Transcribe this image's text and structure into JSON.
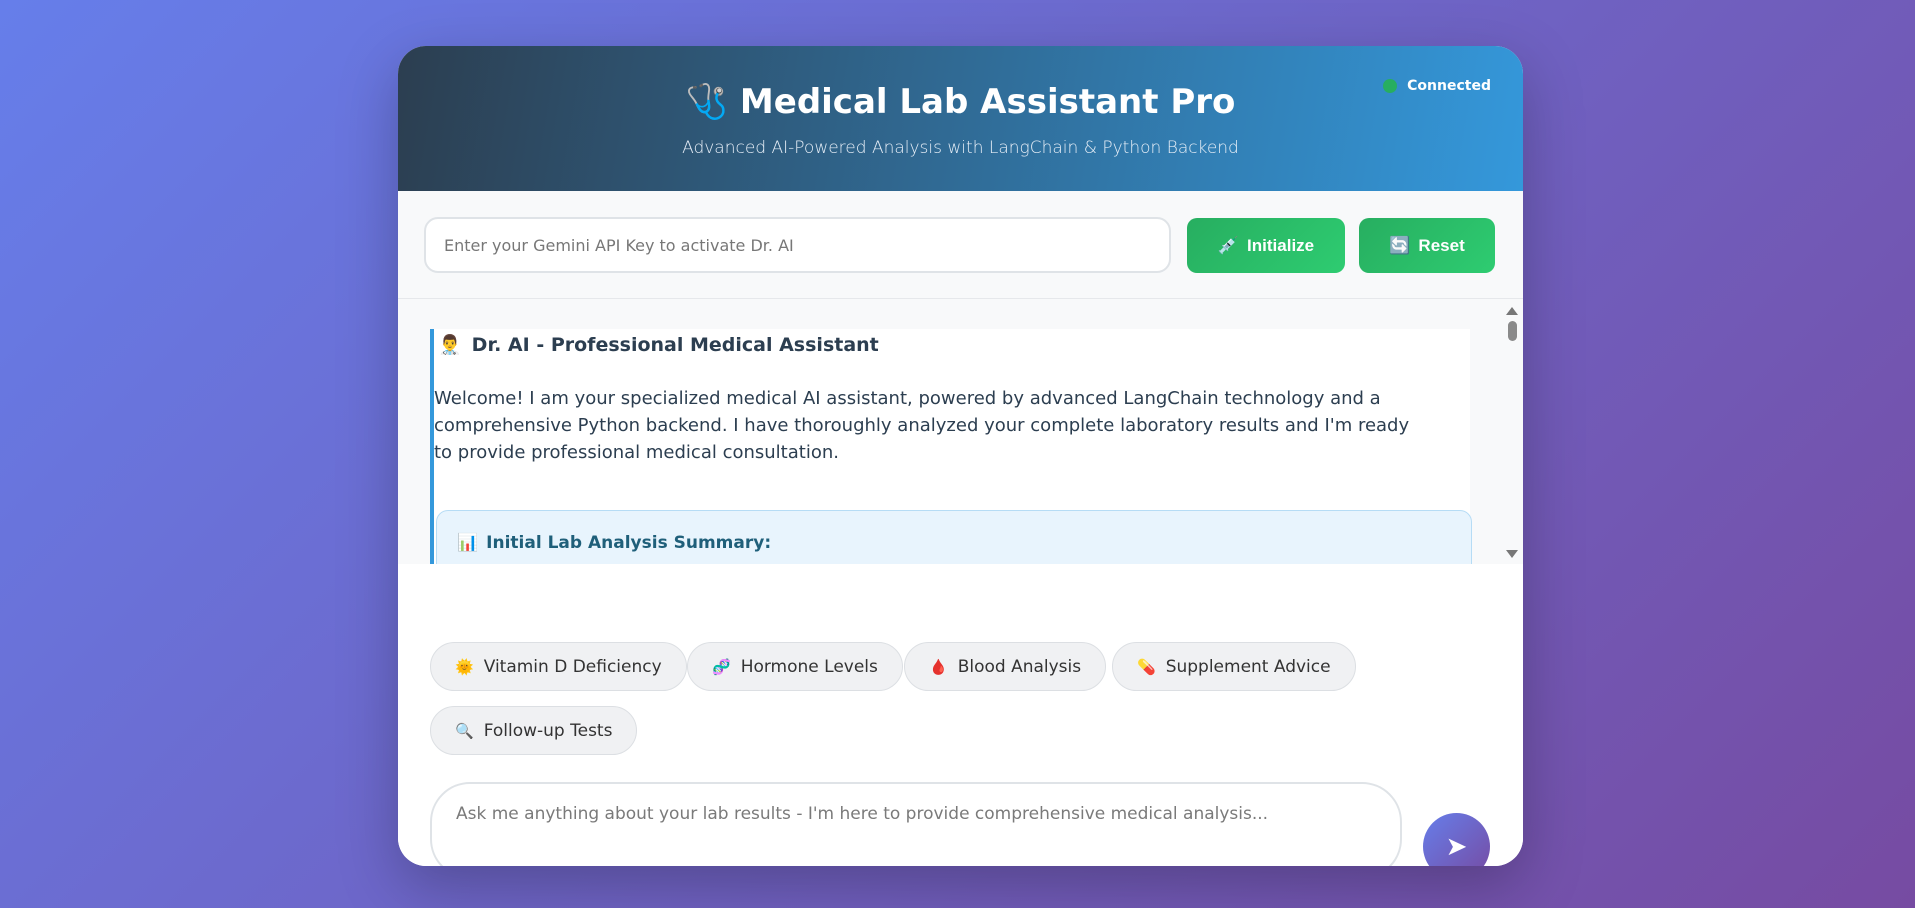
{
  "header": {
    "title": "Medical Lab Assistant Pro",
    "title_icon": "🩺",
    "subtitle": "Advanced AI-Powered Analysis with LangChain & Python Backend",
    "status_text": "Connected",
    "status_color": "#27ae60"
  },
  "api": {
    "placeholder": "Enter your Gemini API Key to activate Dr. AI",
    "value": "",
    "initialize_icon": "💉",
    "initialize_label": "Initialize",
    "reset_icon": "🔄",
    "reset_label": "Reset"
  },
  "chat": {
    "message": {
      "avatar_icon": "👨‍⚕️",
      "title": "Dr. AI - Professional Medical Assistant",
      "body": "Welcome! I am your specialized medical AI assistant, powered by advanced LangChain technology and a comprehensive Python backend. I have thoroughly analyzed your complete laboratory results and I'm ready to provide professional medical consultation.",
      "summary_icon": "📊",
      "summary_title": "Initial Lab Analysis Summary:"
    }
  },
  "quick_actions": [
    {
      "icon": "🌞",
      "label": "Vitamin D Deficiency"
    },
    {
      "icon": "🧬",
      "label": "Hormone Levels"
    },
    {
      "icon": "🩸",
      "label": "Blood Analysis"
    },
    {
      "icon": "💊",
      "label": "Supplement Advice"
    },
    {
      "icon": "🔍",
      "label": "Follow-up Tests"
    }
  ],
  "composer": {
    "placeholder": "Ask me anything about your lab results - I'm here to provide comprehensive medical analysis...",
    "send_icon": "➤"
  },
  "colors": {
    "accent": "#3498db",
    "success": "#27ae60",
    "brand_gradient_start": "#667eea",
    "brand_gradient_end": "#764ba2"
  }
}
